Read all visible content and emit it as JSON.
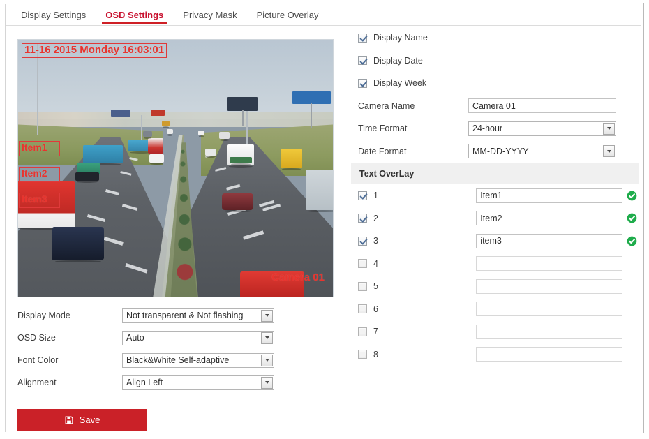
{
  "tabs": [
    {
      "label": "Display Settings",
      "active": false
    },
    {
      "label": "OSD Settings",
      "active": true
    },
    {
      "label": "Privacy Mask",
      "active": false
    },
    {
      "label": "Picture Overlay",
      "active": false
    }
  ],
  "video_preview": {
    "datetime_overlay": "11-16 2015 Monday 16:03:01",
    "item1_overlay": "Item1",
    "item2_overlay": "Item2",
    "item3_overlay": "Item3",
    "camera_overlay": "Camera 01"
  },
  "left_settings": [
    {
      "label": "Display Mode",
      "value": "Not transparent & Not flashing"
    },
    {
      "label": "OSD Size",
      "value": "Auto"
    },
    {
      "label": "Font Color",
      "value": "Black&White Self-adaptive"
    },
    {
      "label": "Alignment",
      "value": "Align Left"
    }
  ],
  "save_button": {
    "label": "Save",
    "icon": "floppy-save-icon",
    "color": "#ca2128"
  },
  "display_options": [
    {
      "label": "Display Name",
      "checked": true
    },
    {
      "label": "Display Date",
      "checked": true
    },
    {
      "label": "Display Week",
      "checked": true
    }
  ],
  "fields": [
    {
      "label": "Camera Name",
      "type": "text",
      "value": "Camera 01",
      "placeholder": ""
    },
    {
      "label": "Time Format",
      "type": "select",
      "value": "24-hour"
    },
    {
      "label": "Date Format",
      "type": "select",
      "value": "MM-DD-YYYY"
    }
  ],
  "text_overlay": {
    "title": "Text OverLay",
    "rows": [
      {
        "num": "1",
        "checked": true,
        "value": "Item1",
        "status": "ok"
      },
      {
        "num": "2",
        "checked": true,
        "value": "Item2",
        "status": "ok"
      },
      {
        "num": "3",
        "checked": true,
        "value": "item3",
        "status": "ok"
      },
      {
        "num": "4",
        "checked": false,
        "value": "",
        "status": ""
      },
      {
        "num": "5",
        "checked": false,
        "value": "",
        "status": ""
      },
      {
        "num": "6",
        "checked": false,
        "value": "",
        "status": ""
      },
      {
        "num": "7",
        "checked": false,
        "value": "",
        "status": ""
      },
      {
        "num": "8",
        "checked": false,
        "value": "",
        "status": ""
      }
    ],
    "status_icon": "green-check-circle-icon",
    "status_color": "#1eac4b"
  }
}
